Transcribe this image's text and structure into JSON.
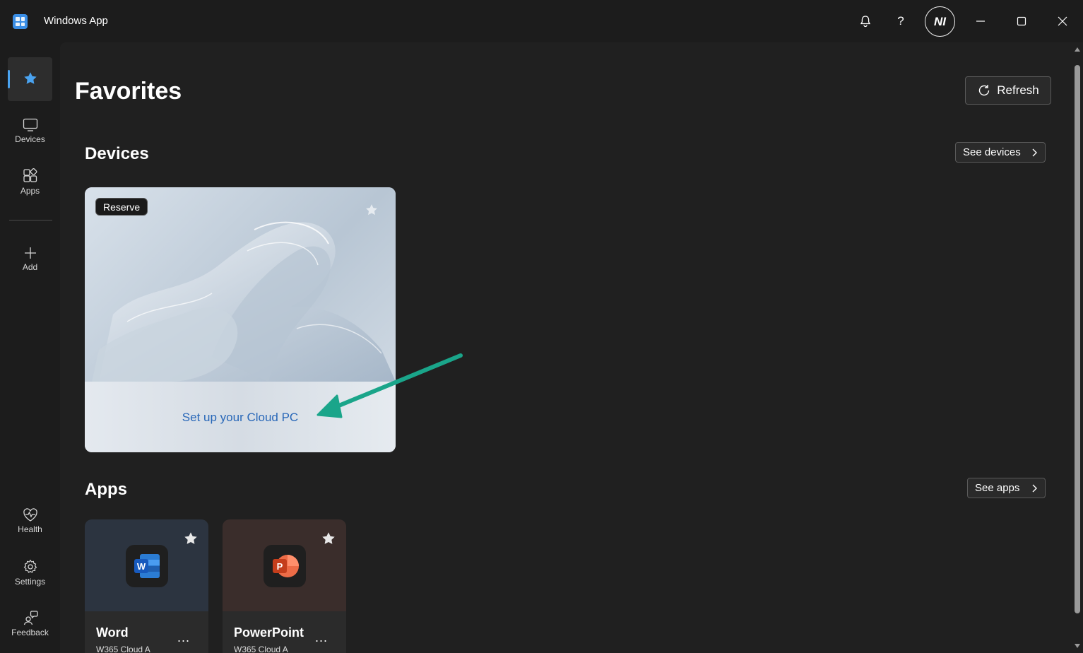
{
  "window": {
    "title": "Windows App"
  },
  "titlebar": {
    "avatar_initials": "NI"
  },
  "sidebar": {
    "items": [
      {
        "label": ""
      },
      {
        "label": "Devices"
      },
      {
        "label": "Apps"
      },
      {
        "label": "Add"
      },
      {
        "label": "Health"
      },
      {
        "label": "Settings"
      },
      {
        "label": "Feedback"
      }
    ]
  },
  "page": {
    "title": "Favorites",
    "refresh_label": "Refresh"
  },
  "devices": {
    "title": "Devices",
    "see_label": "See devices",
    "card": {
      "badge": "Reserve",
      "link": "Set up your Cloud PC"
    }
  },
  "apps": {
    "title": "Apps",
    "see_label": "See apps",
    "items": [
      {
        "name": "Word",
        "subtitle": "W365 Cloud A",
        "more": "..."
      },
      {
        "name": "PowerPoint",
        "subtitle": "W365 Cloud A",
        "more": "..."
      }
    ]
  },
  "colors": {
    "accent": "#4aa3f0",
    "arrow": "#1aa58a",
    "link": "#2867b8"
  }
}
